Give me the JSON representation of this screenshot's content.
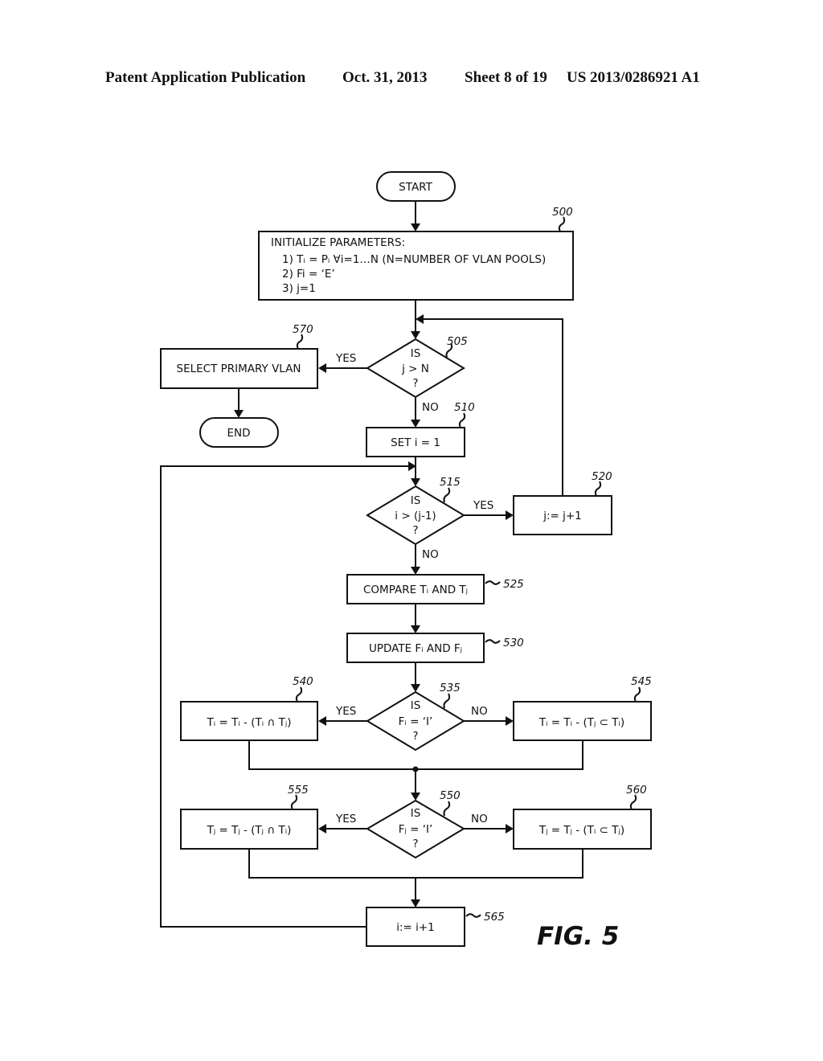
{
  "header": {
    "publication": "Patent Application Publication",
    "date": "Oct. 31, 2013",
    "sheet": "Sheet 8 of 19",
    "number": "US 2013/0286921 A1"
  },
  "figure_label": "FIG. 5",
  "nodes": {
    "start": {
      "text": "START"
    },
    "end": {
      "text": "END"
    },
    "init": {
      "ref": "500",
      "title": "INITIALIZE PARAMETERS:",
      "line1": "1) Tᵢ = Pᵢ ∀i=1…N (N=NUMBER OF VLAN POOLS)",
      "line2": "2) Fi = ‘E’",
      "line3": "3) j=1"
    },
    "d505": {
      "ref": "505",
      "line1": "IS",
      "line2": "j > N",
      "line3": "?"
    },
    "select_primary": {
      "ref": "570",
      "text": "SELECT PRIMARY VLAN"
    },
    "set_i": {
      "ref": "510",
      "text": "SET i = 1"
    },
    "d515": {
      "ref": "515",
      "line1": "IS",
      "line2": "i > (j-1)",
      "line3": "?"
    },
    "inc_j": {
      "ref": "520",
      "text": "j:= j+1"
    },
    "compare": {
      "ref": "525",
      "text": "COMPARE Tᵢ AND Tⱼ"
    },
    "update": {
      "ref": "530",
      "text": "UPDATE Fᵢ AND Fⱼ"
    },
    "d535": {
      "ref": "535",
      "line1": "IS",
      "line2": "Fᵢ = ‘I’",
      "line3": "?"
    },
    "b540": {
      "ref": "540",
      "text": "Tᵢ = Tᵢ - (Tᵢ ∩ Tⱼ)"
    },
    "b545": {
      "ref": "545",
      "text": "Tᵢ = Tᵢ - (Tⱼ ⊂ Tᵢ)"
    },
    "d550": {
      "ref": "550",
      "line1": "IS",
      "line2": "Fⱼ = ‘I’",
      "line3": "?"
    },
    "b555": {
      "ref": "555",
      "text": "Tⱼ = Tⱼ - (Tⱼ ∩ Tᵢ)"
    },
    "b560": {
      "ref": "560",
      "text": "Tⱼ = Tⱼ - (Tᵢ ⊂ Tⱼ)"
    },
    "inc_i": {
      "ref": "565",
      "text": "i:= i+1"
    }
  },
  "edge_labels": {
    "yes": "YES",
    "no": "NO"
  }
}
